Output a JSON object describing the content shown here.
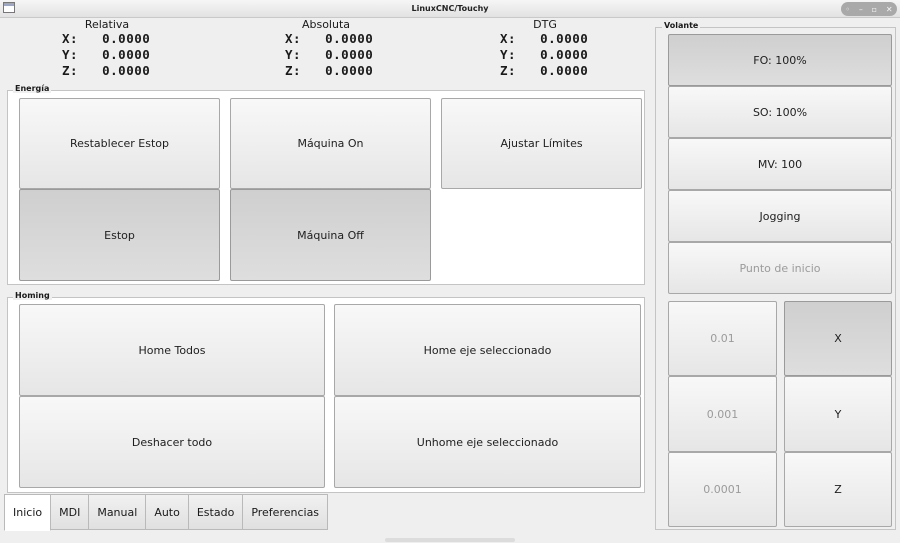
{
  "window": {
    "title": "LinuxCNC/Touchy"
  },
  "dro": {
    "relativa": {
      "heading": "Relativa",
      "x": "X:   0.0000",
      "y": "Y:   0.0000",
      "z": "Z:   0.0000"
    },
    "absoluta": {
      "heading": "Absoluta",
      "x": "X:   0.0000",
      "y": "Y:   0.0000",
      "z": "Z:   0.0000"
    },
    "dtg": {
      "heading": "DTG",
      "x": "X:   0.0000",
      "y": "Y:   0.0000",
      "z": "Z:   0.0000"
    }
  },
  "energia": {
    "legend": "Energía",
    "restablecer": "Restablecer Estop",
    "estop": "Estop",
    "maquina_on": "Máquina On",
    "maquina_off": "Máquina Off",
    "ajustar": "Ajustar Límites"
  },
  "homing": {
    "legend": "Homing",
    "home_todos": "Home Todos",
    "deshacer": "Deshacer todo",
    "home_eje": "Home eje seleccionado",
    "unhome_eje": "Unhome eje seleccionado"
  },
  "volante": {
    "legend": "Volante",
    "fo": "FO: 100%",
    "so": "SO: 100%",
    "mv": "MV: 100",
    "jogging": "Jogging",
    "punto": "Punto de inicio",
    "inc1": "0.01",
    "inc2": "0.001",
    "inc3": "0.0001",
    "axis_x": "X",
    "axis_y": "Y",
    "axis_z": "Z"
  },
  "tabs": [
    "Inicio",
    "MDI",
    "Manual",
    "Auto",
    "Estado",
    "Preferencias"
  ]
}
